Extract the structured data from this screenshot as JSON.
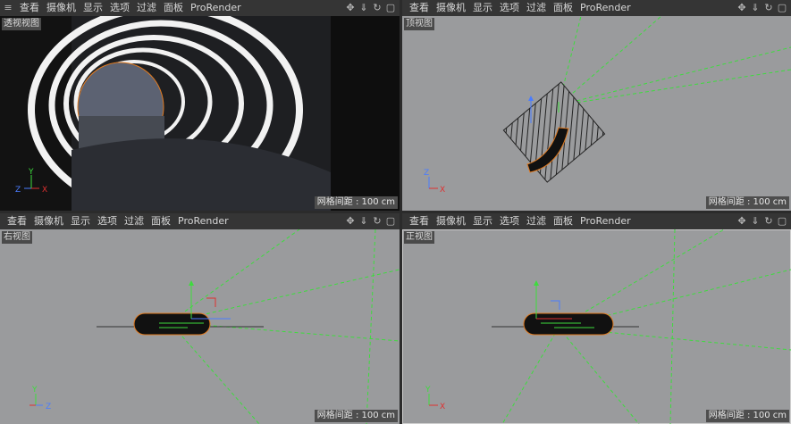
{
  "menu": [
    "查看",
    "摄像机",
    "显示",
    "选项",
    "过滤",
    "面板",
    "ProRender"
  ],
  "icons": {
    "menu": "≡",
    "move": "✥",
    "down": "⇓",
    "rotate": "↻",
    "maximize": "▢"
  },
  "grid_label": "网格间距 : 100 cm",
  "views": {
    "perspective": {
      "label": "透视视图",
      "axes": {
        "y": "Y",
        "z": "Z",
        "x": "X"
      }
    },
    "top": {
      "label": "顶视图",
      "axes": {
        "z": "Z",
        "x": "X"
      }
    },
    "right": {
      "label": "右视图",
      "axes": {
        "y": "Y",
        "z": "Z"
      }
    },
    "front": {
      "label": "正视图",
      "axes": {
        "y": "Y",
        "x": "X"
      }
    }
  },
  "colors": {
    "viewport_gray": "#9a9b9d",
    "menubar": "#353535",
    "guide_green": "#3ddc3d",
    "selection_orange": "#e07a20"
  }
}
